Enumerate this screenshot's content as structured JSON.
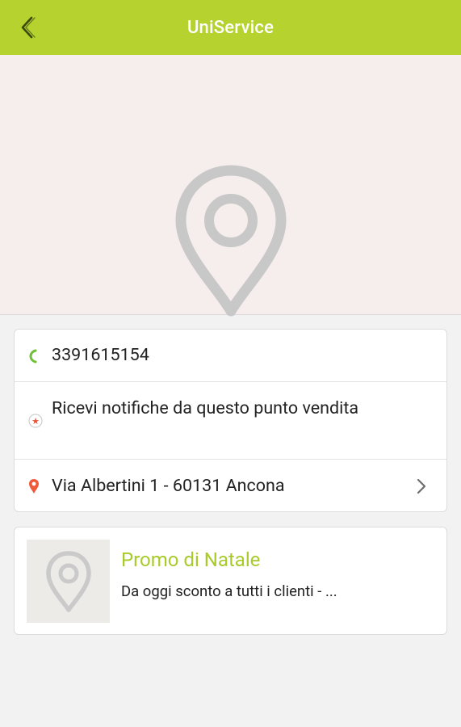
{
  "app": {
    "title": "UniService",
    "accent_color": "#b5d22f"
  },
  "header": {
    "back_icon": "chevron-left-icon"
  },
  "hero": {
    "placeholder_icon": "map-pin-icon"
  },
  "info": {
    "phone": "3391615154",
    "phone_icon": "phone-icon",
    "notifications_label": "Ricevi notifiche da questo punto vendita",
    "notifications_icon": "star-badge-icon",
    "address": "Via Albertini 1 - 60131 Ancona",
    "address_icon": "location-pin-icon",
    "address_chevron": "chevron-right-icon"
  },
  "promo": {
    "title": "Promo di Natale",
    "description": "Da oggi sconto a tutti i clienti - ...",
    "thumbnail_icon": "map-pin-icon",
    "title_color": "#a8cb2a"
  }
}
